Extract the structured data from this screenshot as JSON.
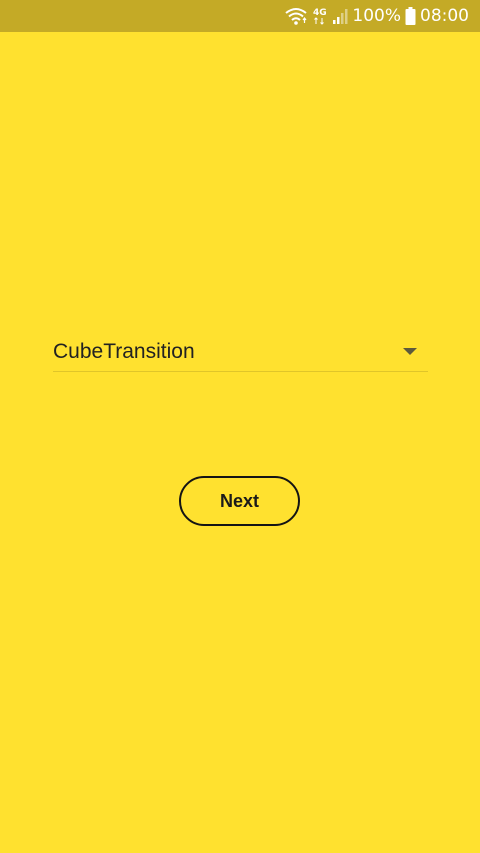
{
  "status_bar": {
    "network_type": "4G",
    "battery_percent": "100%",
    "time": "08:00",
    "icons": [
      "wifi-icon",
      "network-type-icon",
      "signal-icon",
      "battery-icon"
    ]
  },
  "spinner": {
    "selected_value": "CubeTransition",
    "icon": "dropdown-arrow-icon"
  },
  "next_button": {
    "label": "Next"
  },
  "colors": {
    "background": "#FFE12F",
    "status_bar": "#C4AA26",
    "text": "#222222",
    "button_border": "#141414"
  }
}
